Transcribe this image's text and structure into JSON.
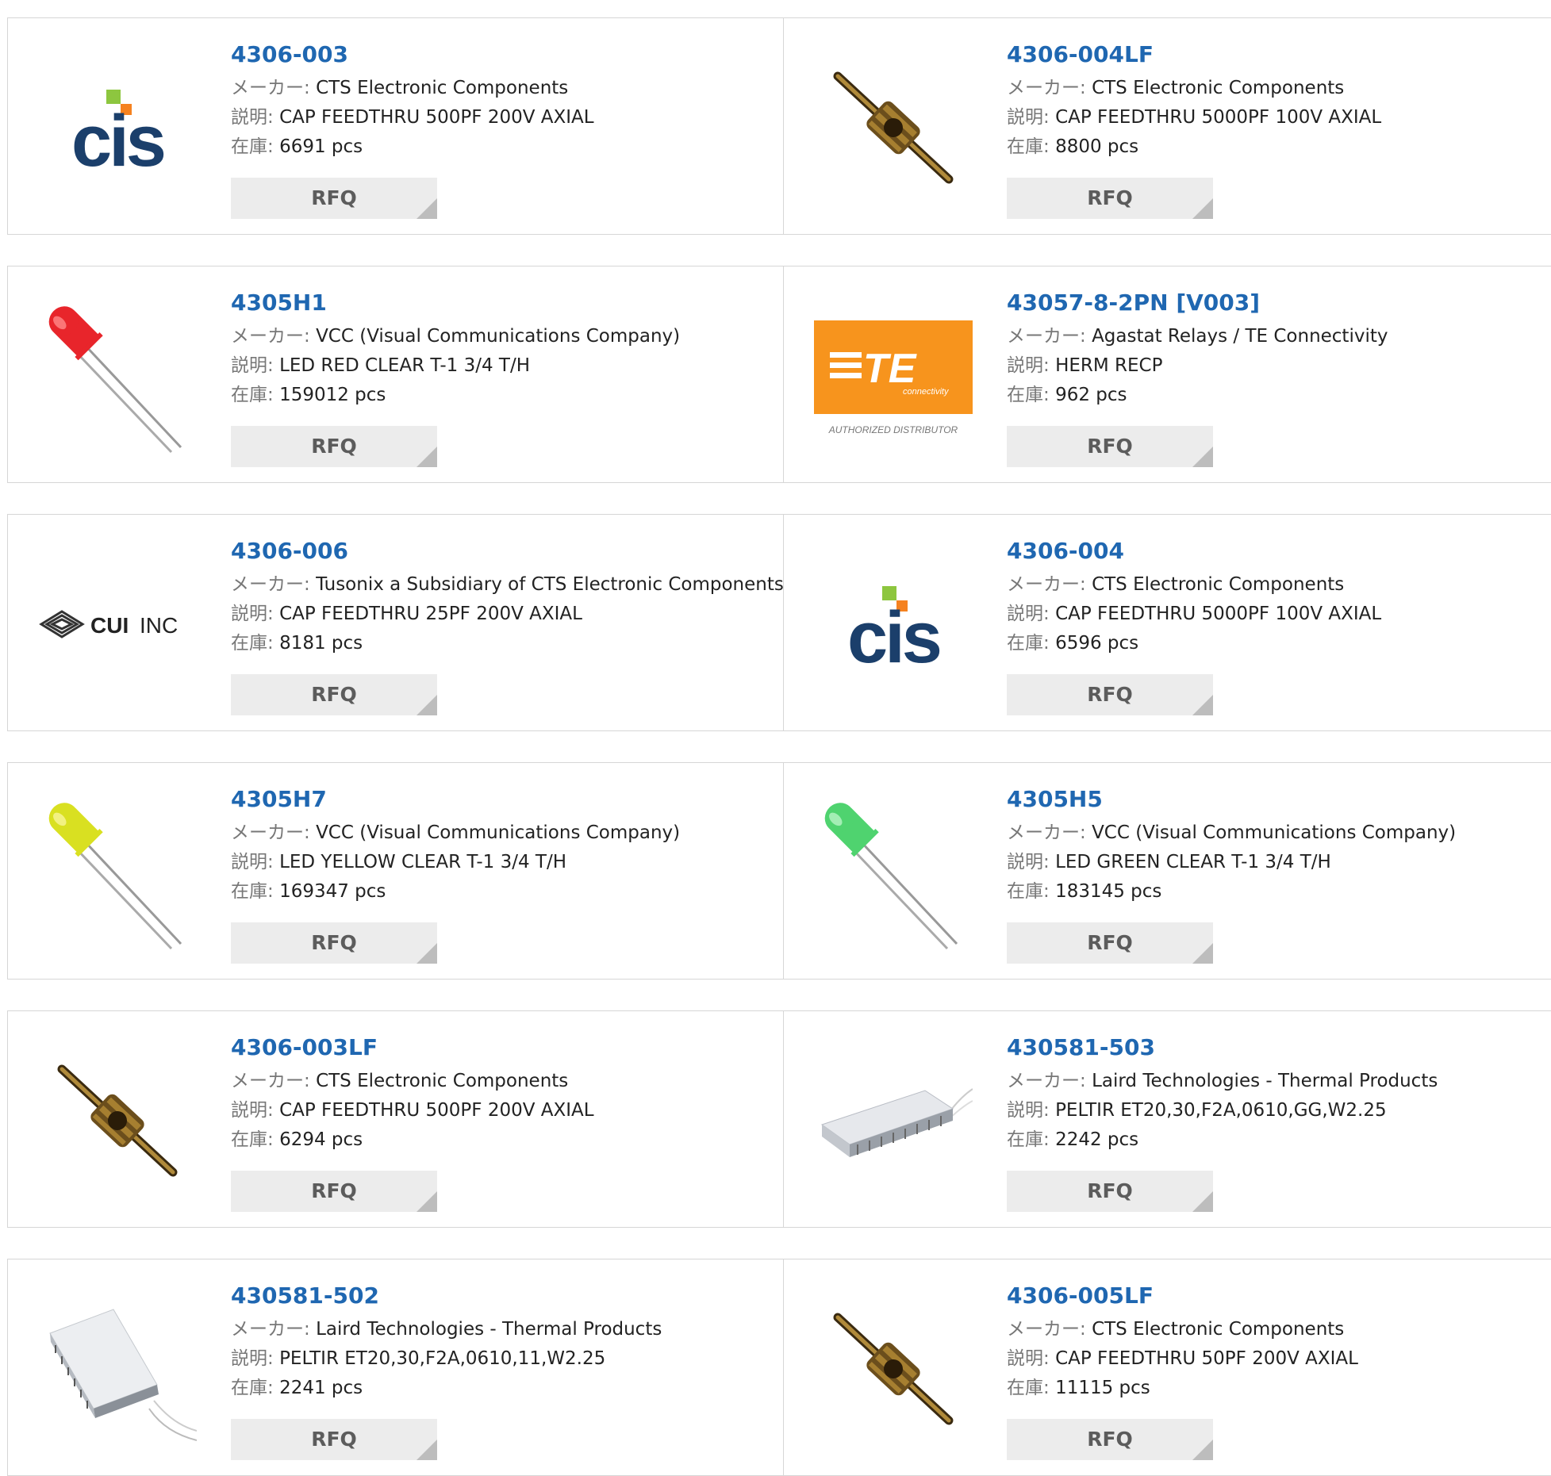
{
  "labels": {
    "maker": "メーカー:",
    "desc": "説明:",
    "stock": "在庫:",
    "rfq": "RFQ"
  },
  "products": [
    {
      "pn": "4306-003",
      "maker": "CTS Electronic Components",
      "desc": "CAP FEEDTHRU 500PF 200V AXIAL",
      "stock": "6691 pcs",
      "image": "cts-logo"
    },
    {
      "pn": "4306-004LF",
      "maker": "CTS Electronic Components",
      "desc": "CAP FEEDTHRU 5000PF 100V AXIAL",
      "stock": "8800 pcs",
      "image": "feedthru-capacitor"
    },
    {
      "pn": "4305H1",
      "maker": "VCC (Visual Communications Company)",
      "desc": "LED RED CLEAR T-1 3/4 T/H",
      "stock": "159012 pcs",
      "image": "led-red"
    },
    {
      "pn": "43057-8-2PN [V003]",
      "maker": "Agastat Relays / TE Connectivity",
      "desc": "HERM RECP",
      "stock": "962 pcs",
      "image": "te-logo",
      "image_text": {
        "brand": "TE",
        "sub": "connectivity",
        "caption": "AUTHORIZED DISTRIBUTOR"
      }
    },
    {
      "pn": "4306-006",
      "maker": "Tusonix a Subsidiary of CTS Electronic Components",
      "desc": "CAP FEEDTHRU 25PF 200V AXIAL",
      "stock": "8181 pcs",
      "image": "cui-logo",
      "image_text": {
        "brand": "CUI",
        "suffix": "INC"
      }
    },
    {
      "pn": "4306-004",
      "maker": "CTS Electronic Components",
      "desc": "CAP FEEDTHRU 5000PF 100V AXIAL",
      "stock": "6596 pcs",
      "image": "cts-logo"
    },
    {
      "pn": "4305H7",
      "maker": "VCC (Visual Communications Company)",
      "desc": "LED YELLOW CLEAR T-1 3/4 T/H",
      "stock": "169347 pcs",
      "image": "led-yellow"
    },
    {
      "pn": "4305H5",
      "maker": "VCC (Visual Communications Company)",
      "desc": "LED GREEN CLEAR T-1 3/4 T/H",
      "stock": "183145 pcs",
      "image": "led-green"
    },
    {
      "pn": "4306-003LF",
      "maker": "CTS Electronic Components",
      "desc": "CAP FEEDTHRU 500PF 200V AXIAL",
      "stock": "6294 pcs",
      "image": "feedthru-capacitor"
    },
    {
      "pn": "430581-503",
      "maker": "Laird Technologies - Thermal Products",
      "desc": "PELTIR ET20,30,F2A,0610,GG,W2.25",
      "stock": "2242 pcs",
      "image": "peltier-module"
    },
    {
      "pn": "430581-502",
      "maker": "Laird Technologies - Thermal Products",
      "desc": "PELTIR ET20,30,F2A,0610,11,W2.25",
      "stock": "2241 pcs",
      "image": "peltier-module-angled"
    },
    {
      "pn": "4306-005LF",
      "maker": "CTS Electronic Components",
      "desc": "CAP FEEDTHRU 50PF 200V AXIAL",
      "stock": "11115 pcs",
      "image": "feedthru-capacitor"
    }
  ]
}
